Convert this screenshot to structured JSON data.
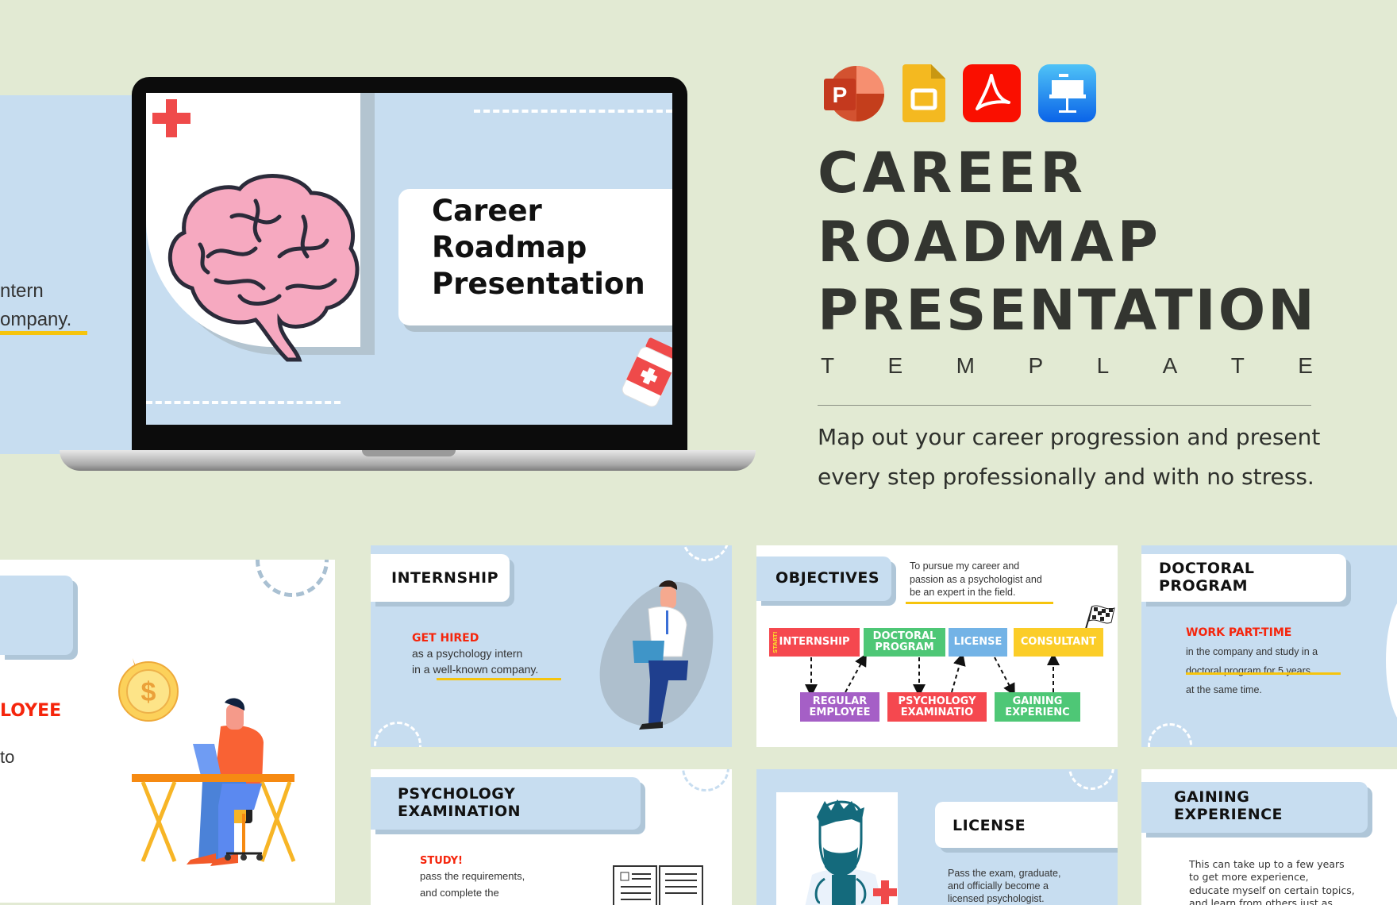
{
  "colors": {
    "background": "#e2ead3",
    "slide_blue": "#c7ddf0",
    "accent_red": "#f5250c",
    "accent_yellow": "#f6c40d",
    "title_dark": "#333530"
  },
  "hero": {
    "app_icons": [
      "powerpoint-icon",
      "google-slides-icon",
      "adobe-acrobat-icon",
      "keynote-icon"
    ],
    "title_lines": [
      "CAREER",
      "ROADMAP",
      "PRESENTATION"
    ],
    "subtitle_letters": [
      "T",
      "E",
      "M",
      "P",
      "L",
      "A",
      "T",
      "E"
    ],
    "description_lines": [
      "Map out your career progression and present",
      "every step professionally and with no stress."
    ]
  },
  "laptop": {
    "slide_title_lines": [
      "Career",
      "Roadmap",
      "Presentation"
    ]
  },
  "left_partial_slide": {
    "lines": [
      "ntern",
      "ompany."
    ]
  },
  "slides": {
    "regular_employee": {
      "heading": "LOYEE",
      "body": "to"
    },
    "internship": {
      "title": "INTERNSHIP",
      "highlight": "GET HIRED",
      "lines": [
        "as a psychology intern",
        "in a well-known company."
      ]
    },
    "objectives": {
      "title": "OBJECTIVES",
      "lines": [
        "To pursue my career and",
        "passion as a psychologist and",
        "be an expert in the field."
      ],
      "start_label": "START!",
      "top_steps": [
        {
          "label": "INTERNSHIP",
          "color": "#f5484f"
        },
        {
          "label": "DOCTORAL PROGRAM",
          "color": "#4ec776"
        },
        {
          "label": "LICENSE",
          "color": "#73b3e6"
        },
        {
          "label": "CONSULTANT",
          "color": "#fbcd28"
        }
      ],
      "bottom_steps": [
        {
          "label": "REGULAR EMPLOYEE",
          "color": "#a55fc6"
        },
        {
          "label": "PSYCHOLOGY EXAMINATIO",
          "color": "#f5484f"
        },
        {
          "label": "GAINING EXPERIENC",
          "color": "#4ec776"
        }
      ]
    },
    "doctoral": {
      "title_lines": [
        "DOCTORAL",
        "PROGRAM"
      ],
      "highlight": "WORK PART-TIME",
      "lines": [
        "in the company and study in a",
        "doctoral program for 5 years",
        "at the same time."
      ]
    },
    "psychology": {
      "title_lines": [
        "PSYCHOLOGY",
        "EXAMINATION"
      ],
      "highlight": "STUDY!",
      "lines": [
        "pass the requirements,",
        "and complete the"
      ]
    },
    "license": {
      "title": "LICENSE",
      "lines": [
        "Pass the exam, graduate,",
        "and officially become a",
        "licensed psychologist."
      ]
    },
    "gaining": {
      "title_lines": [
        "GAINING",
        "EXPERIENCE"
      ],
      "lines": [
        "This can take up to a few years",
        "to get more experience,",
        "educate myself on certain topics,",
        "and learn from others just as"
      ]
    }
  }
}
